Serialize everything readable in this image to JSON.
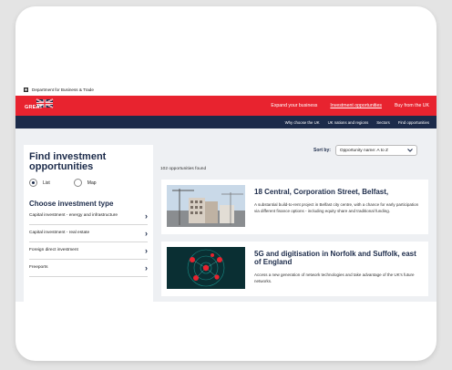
{
  "govbar": {
    "department": "Department for Business & Trade"
  },
  "header": {
    "logo_text": "GREAT",
    "nav": [
      "Expand your business",
      "Investment opportunities",
      "Buy from the UK"
    ],
    "subnav": [
      "Why choose the UK",
      "UK nations and regions",
      "Sectors",
      "Find opportunities"
    ]
  },
  "sidebar": {
    "title": "Find investment opportunities",
    "view_options": [
      "List",
      "Map"
    ],
    "selected_view": "List",
    "type_heading": "Choose investment type",
    "types": [
      "Capital investment - energy and infrastructure",
      "Capital investment - real estate",
      "Foreign direct investment",
      "Freeports"
    ]
  },
  "results": {
    "count_text": "102 opportunities found",
    "sort_label": "Sort by:",
    "sort_value": "Opportunity name: A to Z",
    "items": [
      {
        "title": "18 Central, Corporation Street, Belfast,",
        "description": "A substantial build-to-rent project in Belfast city centre, with a chance for early participation via different finance options - including equity share and traditional funding."
      },
      {
        "title": "5G and digitisation in Norfolk and Suffolk, east of England",
        "description": "Access a new generation of network technologies and take advantage of the UK's future networks."
      }
    ]
  },
  "colors": {
    "brand_red": "#e8232f",
    "navy": "#1c2b4a",
    "panel_bg": "#eef0f3"
  },
  "icons": [
    "crest-icon",
    "union-flag-logo",
    "radio-icon",
    "chevron-right-icon",
    "chevron-down-icon"
  ]
}
